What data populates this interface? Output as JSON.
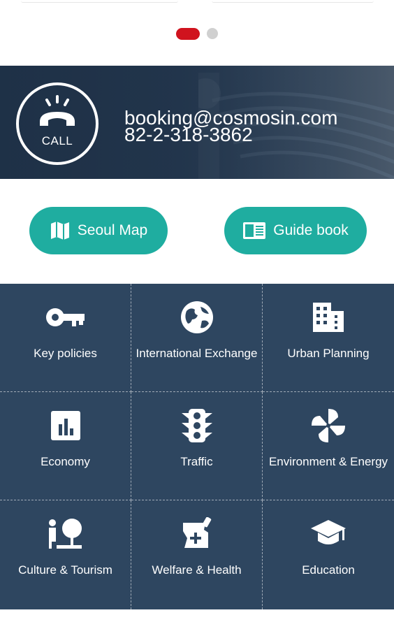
{
  "carousel": {
    "active_index": 0,
    "dot_count": 2
  },
  "contact": {
    "call_label": "CALL",
    "email": "booking@cosmosin.com",
    "phone": "82-2-318-3862"
  },
  "buttons": {
    "seoul_map": "Seoul Map",
    "guide_book": "Guide book"
  },
  "categories": [
    {
      "label": "Key policies",
      "icon": "key-icon"
    },
    {
      "label": "International Exchange",
      "icon": "globe-icon"
    },
    {
      "label": "Urban Planning",
      "icon": "building-icon"
    },
    {
      "label": "Economy",
      "icon": "bar-chart-icon"
    },
    {
      "label": "Traffic",
      "icon": "traffic-light-icon"
    },
    {
      "label": "Environment & Energy",
      "icon": "pinwheel-icon"
    },
    {
      "label": "Culture & Tourism",
      "icon": "tourism-icon"
    },
    {
      "label": "Welfare & Health",
      "icon": "medical-icon"
    },
    {
      "label": "Education",
      "icon": "graduation-cap-icon"
    }
  ],
  "colors": {
    "accent_red": "#d0131e",
    "teal": "#1fada0",
    "navy": "#2e4660"
  }
}
